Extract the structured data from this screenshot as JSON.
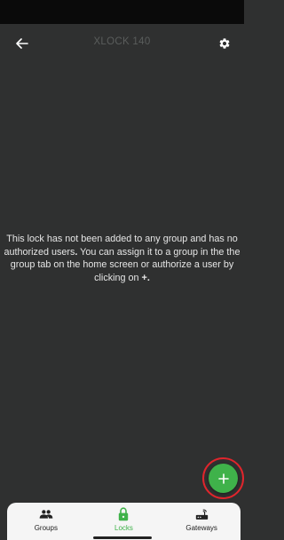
{
  "app_bar": {
    "title": "XLOCK 140",
    "back_icon": "arrow-left-icon",
    "settings_icon": "gear-icon"
  },
  "empty_state": {
    "message_part1": "This lock has not been added to any group and has no authorized users",
    "message_period": ".",
    "message_part2": " You can assign it to a group in the the group tab on the home screen or authorize a user by clicking on ",
    "message_plus": "+",
    "message_end": "."
  },
  "fab": {
    "icon": "plus-icon",
    "color": "#3fb24a",
    "highlight_color": "#e0252c"
  },
  "bottom_nav": {
    "items": [
      {
        "label": "Groups",
        "icon": "people-icon",
        "active": false
      },
      {
        "label": "Locks",
        "icon": "lock-icon",
        "active": true
      },
      {
        "label": "Gateways",
        "icon": "router-icon",
        "active": false
      }
    ],
    "active_color": "#3fb24a"
  },
  "colors": {
    "background": "#2f3030",
    "status_bar": "#0a0a0a",
    "title": "#5a5d5c",
    "text": "#e6e6e6"
  }
}
